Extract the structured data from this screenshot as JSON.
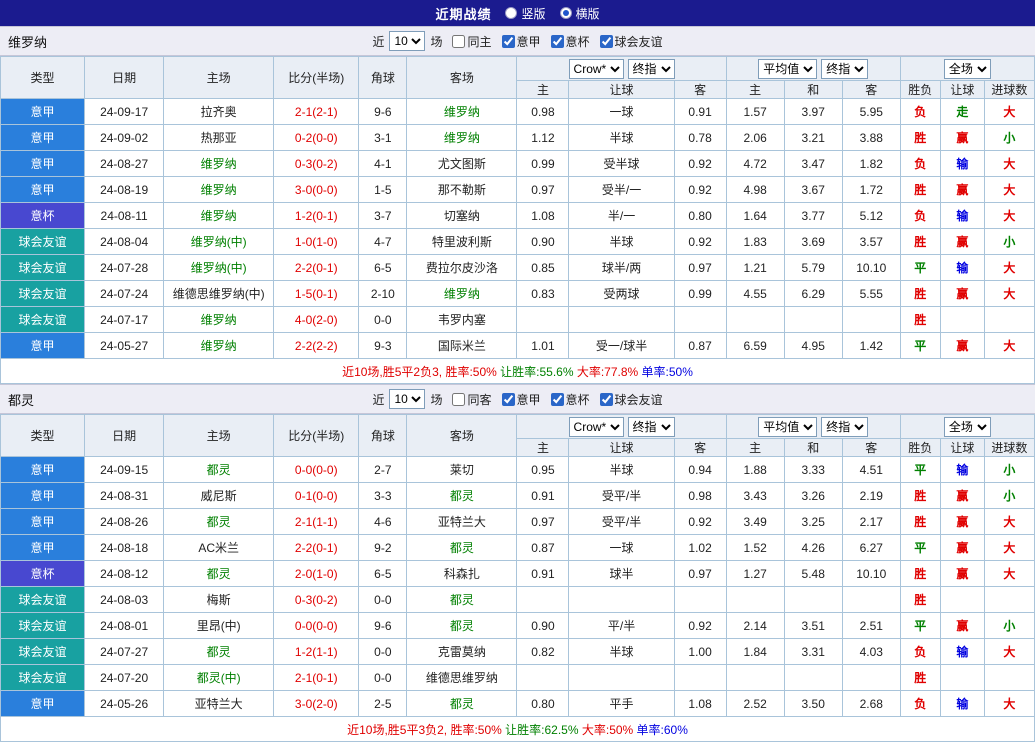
{
  "top_bar": {
    "title": "近期战绩",
    "radios": [
      {
        "label": "竖版",
        "selected": false
      },
      {
        "label": "横版",
        "selected": true
      }
    ]
  },
  "table_header": {
    "left_cols": [
      "类型",
      "日期",
      "主场",
      "比分(半场)",
      "角球",
      "客场"
    ],
    "groups": [
      {
        "selects": [
          "Crow*",
          "终指"
        ],
        "subs": [
          "主",
          "让球",
          "客"
        ]
      },
      {
        "selects": [
          "平均值",
          "终指"
        ],
        "subs": [
          "主",
          "和",
          "客"
        ]
      },
      {
        "selects": [
          "全场"
        ],
        "subs": [
          "胜负",
          "让球",
          "进球数"
        ]
      }
    ]
  },
  "colors": {
    "type_bg": {
      "意甲": "#2a7fdc",
      "意杯": "#4848d0",
      "球会友谊": "#18a1a1"
    },
    "result": {
      "胜": "#e00000",
      "平": "#008000",
      "负": "#e00000",
      "赢": "#e00000",
      "输": "#0000e0",
      "走": "#008000",
      "大": "#e00000",
      "小": "#008000"
    },
    "focus_team": "#008000",
    "score": "#e00000"
  },
  "sections": [
    {
      "team": "维罗纳",
      "filters": {
        "prefix": "近",
        "count": "10",
        "suffix": "场",
        "same": {
          "label": "同主",
          "checked": false
        },
        "leagues": [
          {
            "label": "意甲",
            "checked": true
          },
          {
            "label": "意杯",
            "checked": true
          },
          {
            "label": "球会友谊",
            "checked": true
          }
        ]
      },
      "rows": [
        {
          "type": "意甲",
          "date": "24-09-17",
          "home": "拉齐奥",
          "hf": false,
          "score": "2-1(2-1)",
          "cor": "9-6",
          "away": "维罗纳",
          "af": true,
          "odds": [
            "0.98",
            "一球",
            "0.91",
            "1.57",
            "3.97",
            "5.95"
          ],
          "res": [
            "负",
            "走",
            "大"
          ]
        },
        {
          "type": "意甲",
          "date": "24-09-02",
          "home": "热那亚",
          "hf": false,
          "score": "0-2(0-0)",
          "cor": "3-1",
          "away": "维罗纳",
          "af": true,
          "odds": [
            "1.12",
            "半球",
            "0.78",
            "2.06",
            "3.21",
            "3.88"
          ],
          "res": [
            "胜",
            "赢",
            "小"
          ]
        },
        {
          "type": "意甲",
          "date": "24-08-27",
          "home": "维罗纳",
          "hf": true,
          "score": "0-3(0-2)",
          "cor": "4-1",
          "away": "尤文图斯",
          "af": false,
          "odds": [
            "0.99",
            "受半球",
            "0.92",
            "4.72",
            "3.47",
            "1.82"
          ],
          "res": [
            "负",
            "输",
            "大"
          ]
        },
        {
          "type": "意甲",
          "date": "24-08-19",
          "home": "维罗纳",
          "hf": true,
          "score": "3-0(0-0)",
          "cor": "1-5",
          "away": "那不勒斯",
          "af": false,
          "odds": [
            "0.97",
            "受半/一",
            "0.92",
            "4.98",
            "3.67",
            "1.72"
          ],
          "res": [
            "胜",
            "赢",
            "大"
          ]
        },
        {
          "type": "意杯",
          "date": "24-08-11",
          "home": "维罗纳",
          "hf": true,
          "score": "1-2(0-1)",
          "cor": "3-7",
          "away": "切塞纳",
          "af": false,
          "odds": [
            "1.08",
            "半/一",
            "0.80",
            "1.64",
            "3.77",
            "5.12"
          ],
          "res": [
            "负",
            "输",
            "大"
          ]
        },
        {
          "type": "球会友谊",
          "date": "24-08-04",
          "home": "维罗纳(中)",
          "hf": true,
          "score": "1-0(1-0)",
          "cor": "4-7",
          "away": "特里波利斯",
          "af": false,
          "odds": [
            "0.90",
            "半球",
            "0.92",
            "1.83",
            "3.69",
            "3.57"
          ],
          "res": [
            "胜",
            "赢",
            "小"
          ]
        },
        {
          "type": "球会友谊",
          "date": "24-07-28",
          "home": "维罗纳(中)",
          "hf": true,
          "score": "2-2(0-1)",
          "cor": "6-5",
          "away": "费拉尔皮沙洛",
          "af": false,
          "odds": [
            "0.85",
            "球半/两",
            "0.97",
            "1.21",
            "5.79",
            "10.10"
          ],
          "res": [
            "平",
            "输",
            "大"
          ]
        },
        {
          "type": "球会友谊",
          "date": "24-07-24",
          "home": "维德思维罗纳(中)",
          "hf": false,
          "score": "1-5(0-1)",
          "cor": "2-10",
          "away": "维罗纳",
          "af": true,
          "odds": [
            "0.83",
            "受两球",
            "0.99",
            "4.55",
            "6.29",
            "5.55"
          ],
          "res": [
            "胜",
            "赢",
            "大"
          ]
        },
        {
          "type": "球会友谊",
          "date": "24-07-17",
          "home": "维罗纳",
          "hf": true,
          "score": "4-0(2-0)",
          "cor": "0-0",
          "away": "韦罗内塞",
          "af": false,
          "odds": [
            "",
            "",
            "",
            "",
            "",
            ""
          ],
          "res": [
            "胜",
            "",
            ""
          ]
        },
        {
          "type": "意甲",
          "date": "24-05-27",
          "home": "维罗纳",
          "hf": true,
          "score": "2-2(2-2)",
          "cor": "9-3",
          "away": "国际米兰",
          "af": false,
          "odds": [
            "1.01",
            "受一/球半",
            "0.87",
            "6.59",
            "4.95",
            "1.42"
          ],
          "res": [
            "平",
            "赢",
            "大"
          ]
        }
      ],
      "summary": [
        {
          "text": "近10场,胜5平2负3, 胜率:50% ",
          "color": "#e00000"
        },
        {
          "text": "让胜率:55.6% ",
          "color": "#008000"
        },
        {
          "text": "大率:77.8% ",
          "color": "#e00000"
        },
        {
          "text": "单率:50%",
          "color": "#0000e0"
        }
      ]
    },
    {
      "team": "都灵",
      "filters": {
        "prefix": "近",
        "count": "10",
        "suffix": "场",
        "same": {
          "label": "同客",
          "checked": false
        },
        "leagues": [
          {
            "label": "意甲",
            "checked": true
          },
          {
            "label": "意杯",
            "checked": true
          },
          {
            "label": "球会友谊",
            "checked": true
          }
        ]
      },
      "rows": [
        {
          "type": "意甲",
          "date": "24-09-15",
          "home": "都灵",
          "hf": true,
          "score": "0-0(0-0)",
          "cor": "2-7",
          "away": "莱切",
          "af": false,
          "odds": [
            "0.95",
            "半球",
            "0.94",
            "1.88",
            "3.33",
            "4.51"
          ],
          "res": [
            "平",
            "输",
            "小"
          ]
        },
        {
          "type": "意甲",
          "date": "24-08-31",
          "home": "威尼斯",
          "hf": false,
          "score": "0-1(0-0)",
          "cor": "3-3",
          "away": "都灵",
          "af": true,
          "odds": [
            "0.91",
            "受平/半",
            "0.98",
            "3.43",
            "3.26",
            "2.19"
          ],
          "res": [
            "胜",
            "赢",
            "小"
          ]
        },
        {
          "type": "意甲",
          "date": "24-08-26",
          "home": "都灵",
          "hf": true,
          "score": "2-1(1-1)",
          "cor": "4-6",
          "away": "亚特兰大",
          "af": false,
          "odds": [
            "0.97",
            "受平/半",
            "0.92",
            "3.49",
            "3.25",
            "2.17"
          ],
          "res": [
            "胜",
            "赢",
            "大"
          ]
        },
        {
          "type": "意甲",
          "date": "24-08-18",
          "home": "AC米兰",
          "hf": false,
          "score": "2-2(0-1)",
          "cor": "9-2",
          "away": "都灵",
          "af": true,
          "odds": [
            "0.87",
            "一球",
            "1.02",
            "1.52",
            "4.26",
            "6.27"
          ],
          "res": [
            "平",
            "赢",
            "大"
          ]
        },
        {
          "type": "意杯",
          "date": "24-08-12",
          "home": "都灵",
          "hf": true,
          "score": "2-0(1-0)",
          "cor": "6-5",
          "away": "科森扎",
          "af": false,
          "odds": [
            "0.91",
            "球半",
            "0.97",
            "1.27",
            "5.48",
            "10.10"
          ],
          "res": [
            "胜",
            "赢",
            "大"
          ]
        },
        {
          "type": "球会友谊",
          "date": "24-08-03",
          "home": "梅斯",
          "hf": false,
          "score": "0-3(0-2)",
          "cor": "0-0",
          "away": "都灵",
          "af": true,
          "odds": [
            "",
            "",
            "",
            "",
            "",
            ""
          ],
          "res": [
            "胜",
            "",
            ""
          ]
        },
        {
          "type": "球会友谊",
          "date": "24-08-01",
          "home": "里昂(中)",
          "hf": false,
          "score": "0-0(0-0)",
          "cor": "9-6",
          "away": "都灵",
          "af": true,
          "odds": [
            "0.90",
            "平/半",
            "0.92",
            "2.14",
            "3.51",
            "2.51"
          ],
          "res": [
            "平",
            "赢",
            "小"
          ]
        },
        {
          "type": "球会友谊",
          "date": "24-07-27",
          "home": "都灵",
          "hf": true,
          "score": "1-2(1-1)",
          "cor": "0-0",
          "away": "克雷莫纳",
          "af": false,
          "odds": [
            "0.82",
            "半球",
            "1.00",
            "1.84",
            "3.31",
            "4.03"
          ],
          "res": [
            "负",
            "输",
            "大"
          ]
        },
        {
          "type": "球会友谊",
          "date": "24-07-20",
          "home": "都灵(中)",
          "hf": true,
          "score": "2-1(0-1)",
          "cor": "0-0",
          "away": "维德思维罗纳",
          "af": false,
          "odds": [
            "",
            "",
            "",
            "",
            "",
            ""
          ],
          "res": [
            "胜",
            "",
            ""
          ]
        },
        {
          "type": "意甲",
          "date": "24-05-26",
          "home": "亚特兰大",
          "hf": false,
          "score": "3-0(2-0)",
          "cor": "2-5",
          "away": "都灵",
          "af": true,
          "odds": [
            "0.80",
            "平手",
            "1.08",
            "2.52",
            "3.50",
            "2.68"
          ],
          "res": [
            "负",
            "输",
            "大"
          ]
        }
      ],
      "summary": [
        {
          "text": "近10场,胜5平3负2, 胜率:50% ",
          "color": "#e00000"
        },
        {
          "text": "让胜率:62.5% ",
          "color": "#008000"
        },
        {
          "text": "大率:50% ",
          "color": "#e00000"
        },
        {
          "text": "单率:60%",
          "color": "#0000e0"
        }
      ]
    }
  ]
}
